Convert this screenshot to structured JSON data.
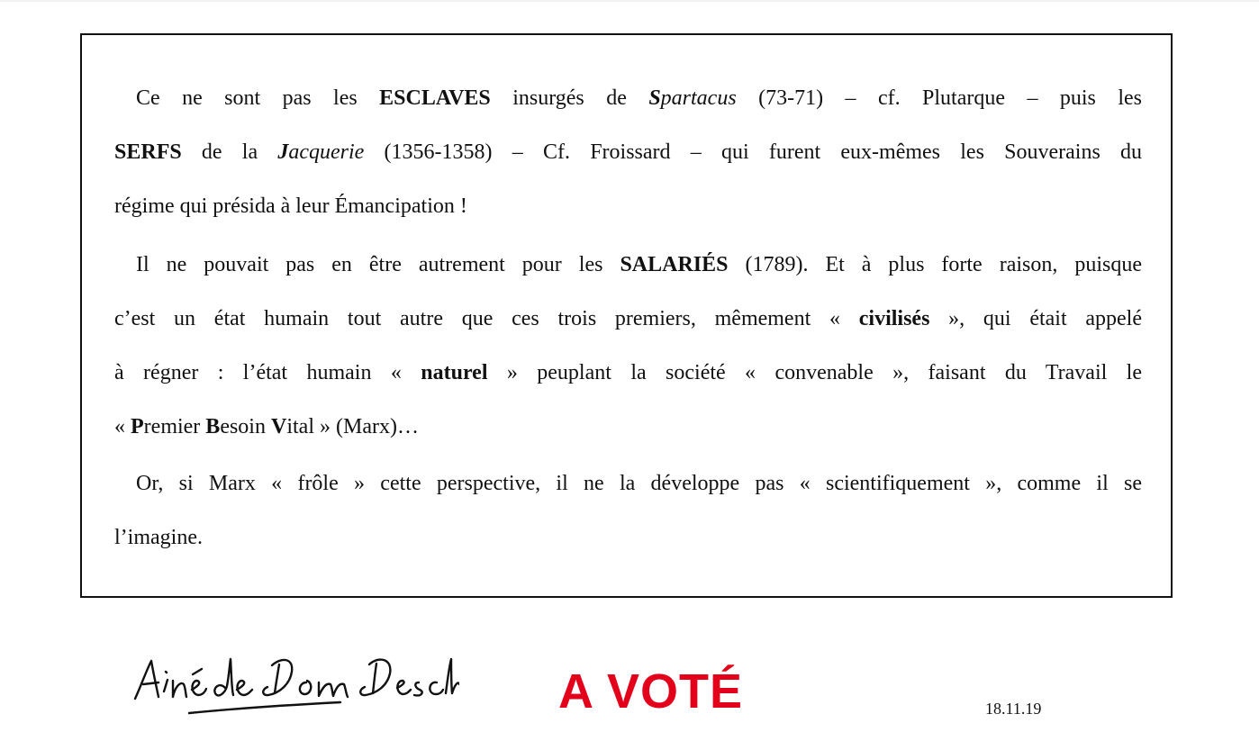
{
  "document": {
    "paragraph_1": {
      "line_1": {
        "s1": "Ce ne sont pas les ",
        "s2": "ESCLAVES",
        "s3": " insurgés de ",
        "s4": "S",
        "s5": "partacus",
        "s6": " (73-71) – cf. Plutarque – puis les"
      },
      "line_2": {
        "s1": "SERFS",
        "s2": " de la ",
        "s3": "J",
        "s4": "acquerie",
        "s5": " (1356-1358) – Cf. Froissard – qui furent eux-mêmes les Souverains du"
      },
      "line_3": {
        "s1": "régime qui présida à leur Émancipation !"
      }
    },
    "paragraph_2": {
      "line_1": {
        "s1": "Il ne pouvait pas en être autrement pour les ",
        "s2": "SALARIÉS",
        "s3": " (1789). Et à plus forte raison, puisque"
      },
      "line_2": {
        "s1": "c’est un état humain tout autre que ces trois premiers, mêmement « ",
        "s2": "civilisés",
        "s3": " », qui était appelé"
      },
      "line_3": {
        "s1": "à régner : l’état humain « ",
        "s2": "naturel",
        "s3": " » peuplant la société « convenable », faisant du Travail le"
      },
      "line_4": {
        "s1": "« ",
        "s2": "P",
        "s3": "remier ",
        "s4": "B",
        "s5": "esoin ",
        "s6": "V",
        "s7": "ital » (Marx)…"
      }
    },
    "paragraph_3": {
      "line_1": {
        "s1": "Or, si Marx « frôle » cette perspective, il ne la développe pas « scientifiquement », comme il se"
      },
      "line_2": {
        "s1": "l’imagine."
      }
    }
  },
  "signature": {
    "text": "Aîné de Dom Deschamps"
  },
  "stamp": {
    "text": "A VOTÉ",
    "color": "#e3001b"
  },
  "date": "18.11.19"
}
